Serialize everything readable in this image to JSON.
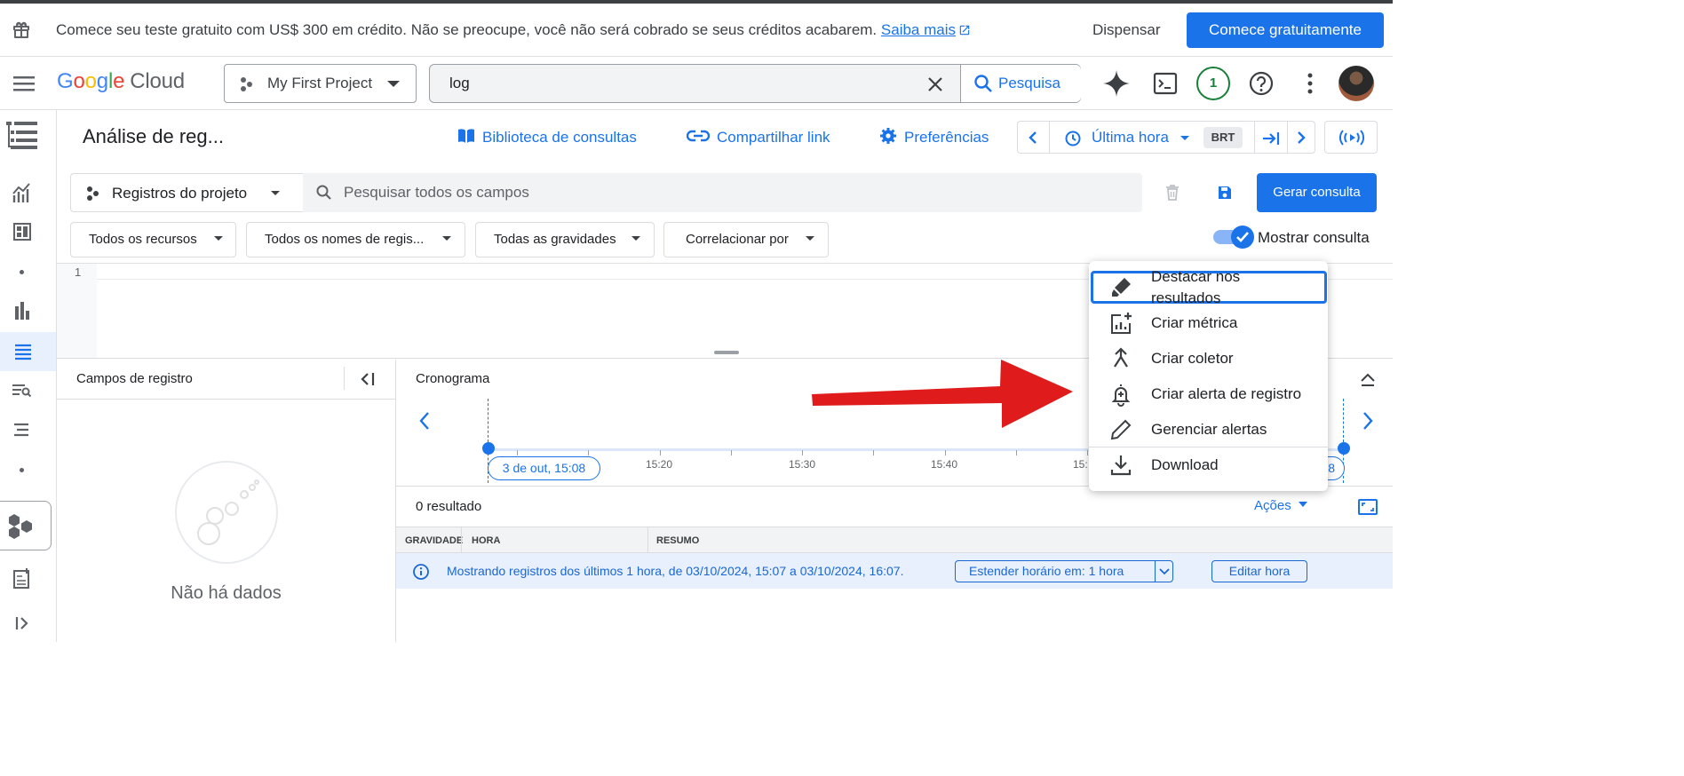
{
  "banner": {
    "message": "Comece seu teste gratuito com US$ 300 em crédito. Não se preocupe, você não será cobrado se seus créditos acabarem.",
    "link": "Saiba mais",
    "dismiss": "Dispensar",
    "start": "Comece gratuitamente"
  },
  "header": {
    "logo_google": [
      "G",
      "o",
      "o",
      "g",
      "l",
      "e"
    ],
    "logo_cloud": "Cloud",
    "project": "My First Project",
    "search_value": "log",
    "search_button": "Pesquisa",
    "notifications": "1"
  },
  "toolbar": {
    "title": "Análise de reg...",
    "library": "Biblioteca de consultas",
    "share": "Compartilhar link",
    "preferences": "Preferências",
    "time_range": "Última hora",
    "timezone": "BRT"
  },
  "query": {
    "scope": "Registros do projeto",
    "search_placeholder": "Pesquisar todos os campos",
    "generate": "Gerar consulta",
    "filters": [
      "Todos os recursos",
      "Todos os nomes de regis...",
      "Todas as gravidades",
      "Correlacionar por"
    ],
    "show_query": "Mostrar consulta",
    "line_number": "1"
  },
  "fields_panel": {
    "title": "Campos de registro",
    "empty": "Não há dados"
  },
  "timeline": {
    "title": "Cronograma",
    "start_label": "3 de out, 15:08",
    "tick_labels": [
      "15:20",
      "15:30",
      "15:40",
      "15:"
    ],
    "end_label_partial": "8"
  },
  "results": {
    "count": "0 resultado",
    "actions": "Ações",
    "columns": [
      "GRAVIDADE",
      "HORA",
      "RESUMO"
    ],
    "info": "Mostrando registros dos últimos 1 hora, de 03/10/2024, 15:07 a 03/10/2024, 16:07.",
    "extend": "Estender horário em: 1 hora",
    "edit_time": "Editar hora"
  },
  "menu": {
    "items": [
      {
        "label": "Destacar nos resultados",
        "icon": "highlighter-icon"
      },
      {
        "label": "Criar métrica",
        "icon": "add-chart-icon"
      },
      {
        "label": "Criar coletor",
        "icon": "merge-icon"
      },
      {
        "label": "Criar alerta de registro",
        "icon": "add-alert-icon"
      },
      {
        "label": "Gerenciar alertas",
        "icon": "edit-icon"
      },
      {
        "label": "Download",
        "icon": "download-icon"
      }
    ],
    "first_label_line1": "Destacar nos",
    "first_label_line2": "resultados"
  },
  "colors": {
    "accent": "#1a73e8",
    "annotation_arrow": "#e01b1b",
    "info_bg": "#e8f0fe"
  }
}
